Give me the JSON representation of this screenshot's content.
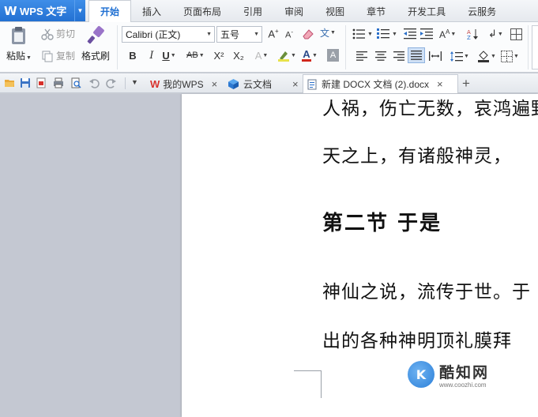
{
  "app": {
    "name": "WPS 文字",
    "logo_glyph": "W",
    "accent": "#2a78db"
  },
  "menu_tabs": [
    "开始",
    "插入",
    "页面布局",
    "引用",
    "审阅",
    "视图",
    "章节",
    "开发工具",
    "云服务"
  ],
  "ribbon": {
    "paste_label": "粘贴",
    "cut_label": "剪切",
    "copy_label": "复制",
    "format_painter_label": "格式刷",
    "font_name": "Calibri (正文)",
    "font_size": "五号",
    "phonetic_glyph": "文",
    "bold": "B",
    "italic": "I",
    "underline": "U",
    "strike": "AB",
    "superscript": "X²",
    "subscript": "X₂",
    "font_color_glyph": "A",
    "char_shade_glyph": "A"
  },
  "doc_tabs": [
    {
      "label": "我的WPS",
      "icon": "wps-logo-icon"
    },
    {
      "label": "云文档",
      "icon": "cloud-doc-icon"
    },
    {
      "label": "新建 DOCX 文档 (2).docx",
      "icon": "document-icon",
      "active": true
    }
  ],
  "document": {
    "line1": "人祸，伤亡无数，哀鸿遍野",
    "line2": "天之上，有诸般神灵，",
    "heading": "第二节  于是",
    "line3": "神仙之说，流传于世。于",
    "line4": "出的各种神明顶礼膜拜"
  },
  "watermark": {
    "name": "酷知网",
    "url": "www.coozhi.com"
  }
}
